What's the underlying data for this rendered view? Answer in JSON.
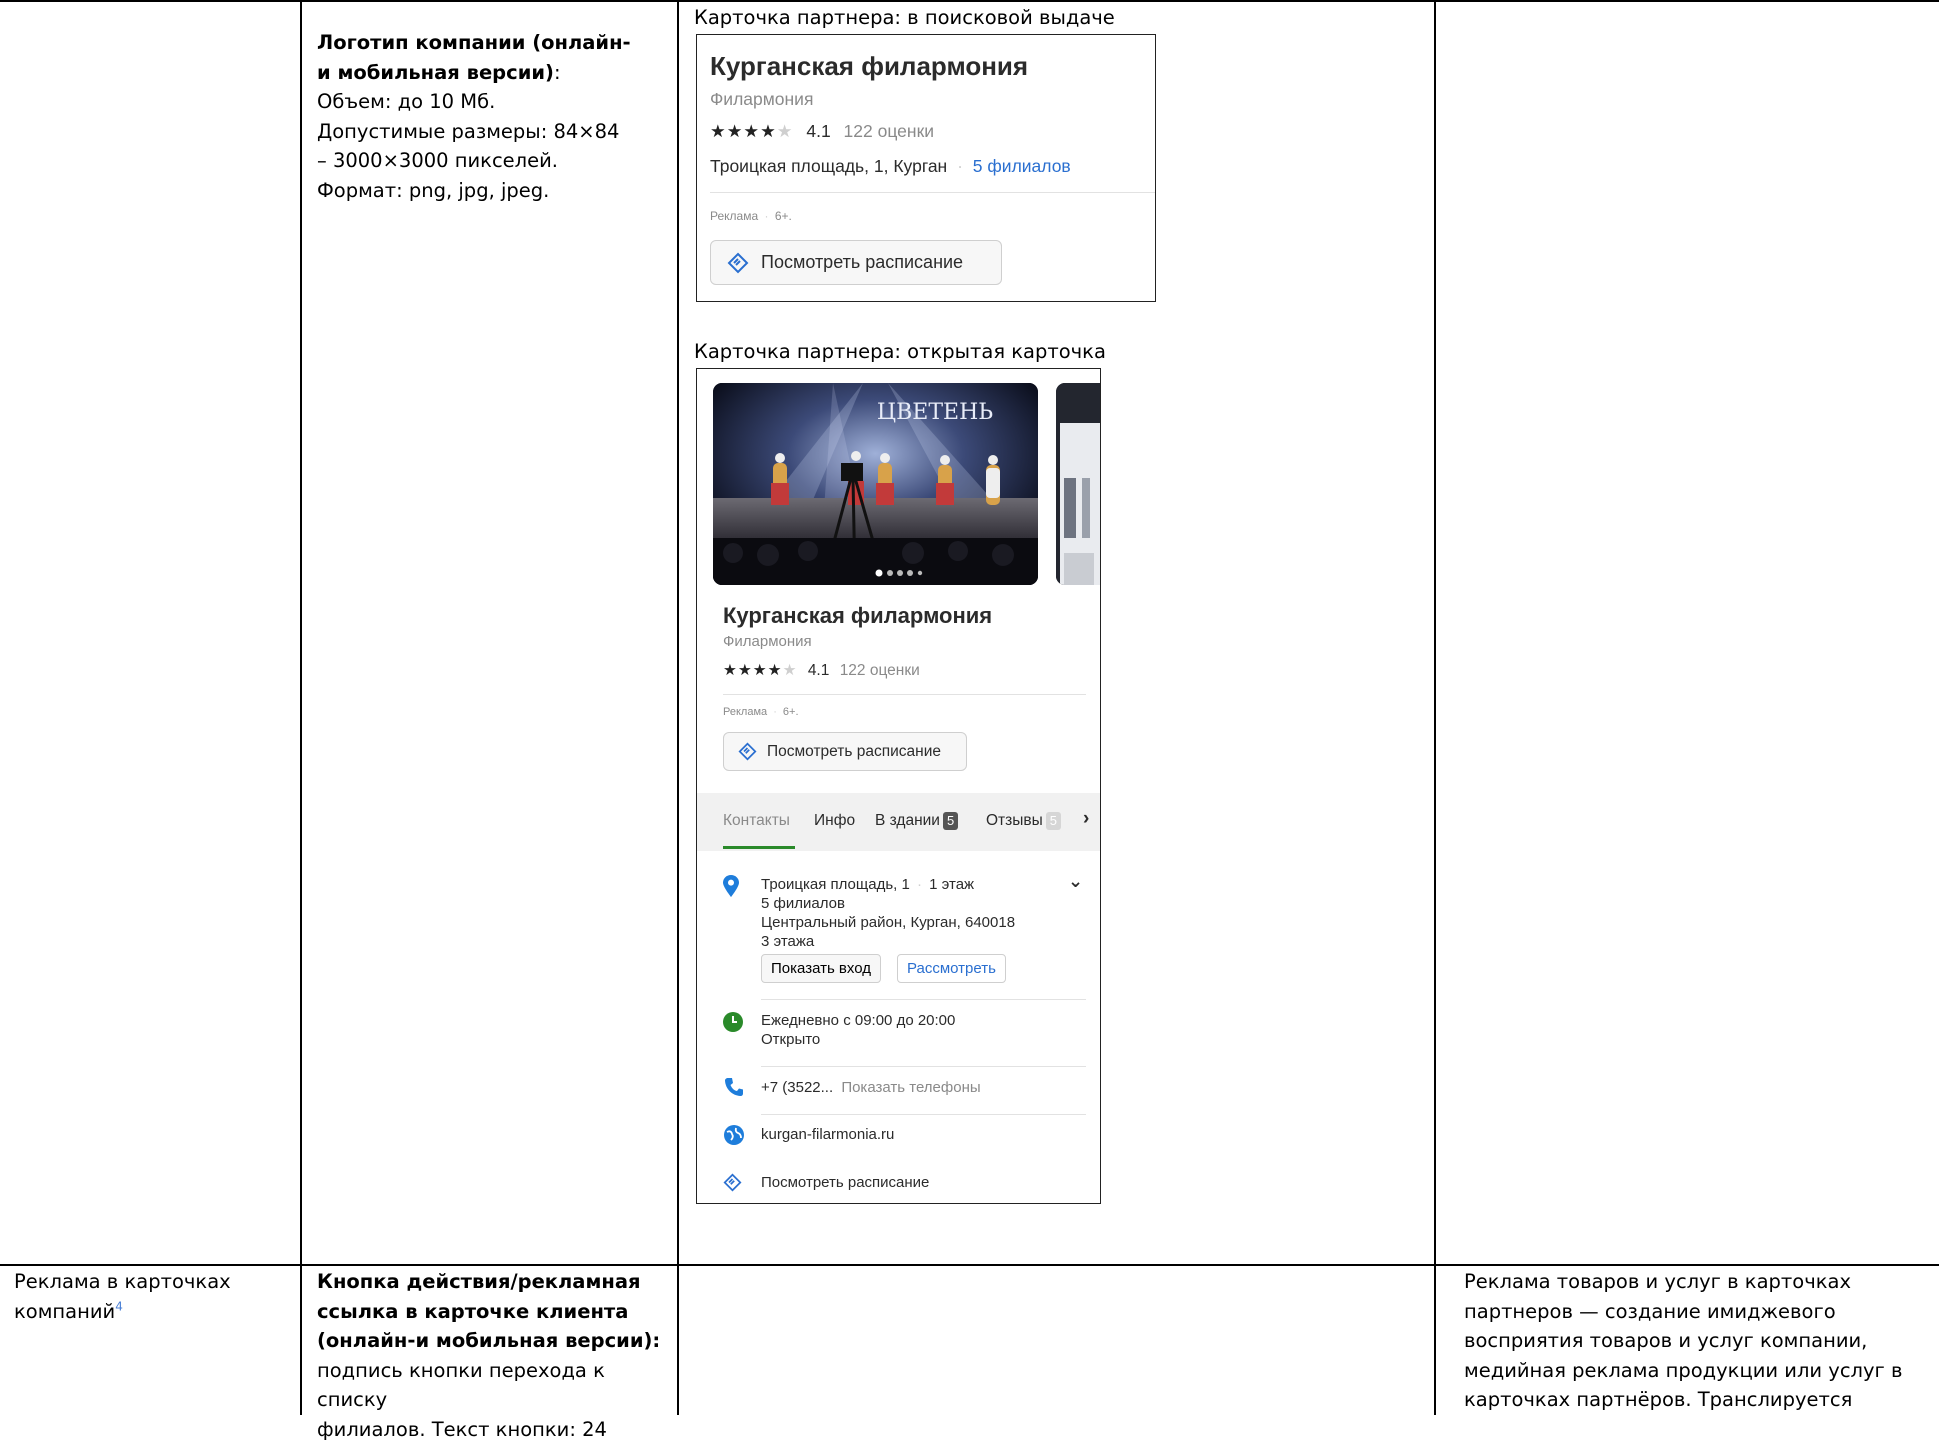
{
  "row1": {
    "col2": {
      "heading": "Логотип компании (онлайн-и мобильная версии)",
      "heading_line1": "Логотип компании (онлайн-",
      "heading_line2": "и мобильная версии)",
      "heading_colon": ":",
      "lines": [
        "Объем: до 10 Мб.",
        "Допустимые размеры: 84×84",
        "– 3000×3000 пикселей.",
        "Формат: png, jpg, jpeg."
      ]
    },
    "col3": {
      "caption_search": "Карточка партнера: в поисковой выдаче",
      "caption_open": "Карточка партнера: открытая карточка",
      "search_card": {
        "title": "Курганская филармония",
        "category": "Филармония",
        "rating": "4.1",
        "reviews": "122 оценки",
        "stars_filled": 4,
        "stars_total": 5,
        "address": "Троицкая площадь, 1, Курган",
        "separator": "·",
        "branches": "5 филиалов",
        "ad_label": "Реклама",
        "age": "6+.",
        "button": "Посмотреть расписание"
      },
      "open_card": {
        "photo_sign": "ЦВЕТЕНЬ",
        "title": "Курганская филармония",
        "category": "Филармония",
        "rating": "4.1",
        "reviews": "122 оценки",
        "ad_label": "Реклама",
        "age": "6+.",
        "button": "Посмотреть расписание",
        "tabs": [
          {
            "label": "Контакты"
          },
          {
            "label": "Инфо"
          },
          {
            "label": "В здании",
            "badge": "5"
          },
          {
            "label": "Отзывы",
            "badge": "5"
          }
        ],
        "address": "Троицкая площадь, 1",
        "floor": "1 этаж",
        "branches": "5 филиалов",
        "district": "Центральный район, Курган, 640018",
        "floors": "3 этажа",
        "show_entrance": "Показать вход",
        "view": "Рассмотреть",
        "hours": "Ежедневно с 09:00 до 20:00",
        "open_status": "Открыто",
        "phone": "+7 (3522...",
        "show_phones": "Показать телефоны",
        "website": "kurgan-filarmonia.ru",
        "schedule_link": "Посмотреть расписание"
      }
    }
  },
  "row2": {
    "col1": {
      "line1": "Реклама в карточках",
      "line2": "компаний",
      "footnote": "4"
    },
    "col2": {
      "bold_lines": [
        "Кнопка действия/рекламная",
        "ссылка в карточке клиента",
        "(онлайн-и мобильная версии):"
      ],
      "lines": [
        "подпись кнопки перехода к списку",
        "филиалов. Текст кнопки: 24"
      ]
    },
    "col4": {
      "lines": [
        "Реклама товаров и услуг в карточках",
        "партнеров — создание имиджевого",
        "восприятия товаров и услуг компании,",
        "медийная реклама продукции или услуг в",
        "карточках партнёров. Транслируется"
      ]
    }
  },
  "colors": {
    "link_blue": "#2a6fd0",
    "open_green": "#2a8a2a",
    "pin_blue": "#1e7ddb"
  }
}
